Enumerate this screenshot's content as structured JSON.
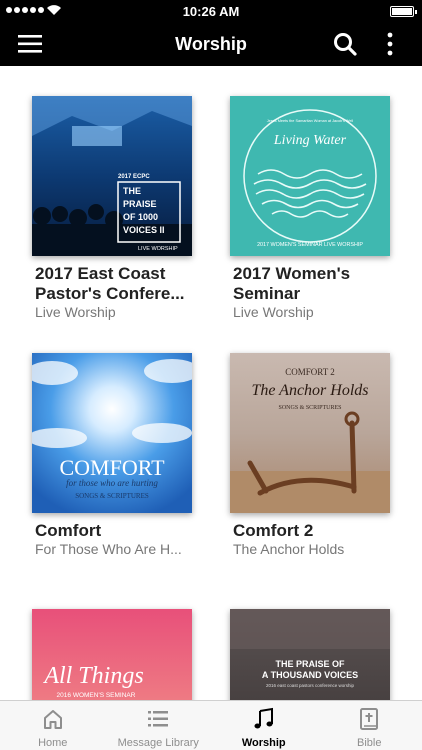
{
  "status_bar": {
    "time": "10:26 AM"
  },
  "nav": {
    "title": "Worship"
  },
  "albums": [
    {
      "title": "2017 East Coast Pastor's Confere...",
      "subtitle": "Live Worship",
      "art_lines": [
        "2017 ECPC",
        "THE",
        "PRAISE",
        "OF 1000",
        "VOICES II",
        "LIVE WORSHIP"
      ]
    },
    {
      "title": "2017 Women's Seminar",
      "subtitle": "Live Worship",
      "art_lines": [
        "Living Water",
        "2017 WOMEN'S SEMINAR LIVE WORSHIP",
        "Jesus Meets the Samaritan Woman at Jacob's Well"
      ]
    },
    {
      "title": "Comfort",
      "subtitle": "For Those Who Are H...",
      "art_lines": [
        "COMFORT",
        "for those who are hurting",
        "SONGS & SCRIPTURES"
      ]
    },
    {
      "title": "Comfort 2",
      "subtitle": "The Anchor Holds",
      "art_lines": [
        "COMFORT 2",
        "The Anchor Holds",
        "SONGS & SCRIPTURES"
      ]
    },
    {
      "title": "",
      "subtitle": "",
      "art_lines": [
        "All Things",
        "2016 WOMEN'S SEMINAR"
      ]
    },
    {
      "title": "",
      "subtitle": "",
      "art_lines": [
        "THE PRAISE OF",
        "A THOUSAND VOICES",
        "2016 east coast pastors conference worship"
      ]
    }
  ],
  "tabs": [
    {
      "label": "Home",
      "icon": "home-icon"
    },
    {
      "label": "Message Library",
      "icon": "list-icon"
    },
    {
      "label": "Worship",
      "icon": "music-note-icon"
    },
    {
      "label": "Bible",
      "icon": "bible-icon"
    }
  ],
  "colors": {
    "nav_bg": "#000000",
    "tab_active": "#000000",
    "tab_inactive": "#8e8e8e"
  }
}
